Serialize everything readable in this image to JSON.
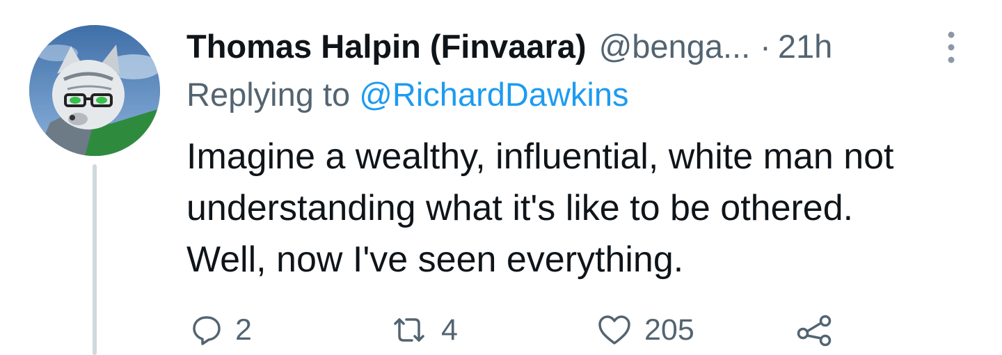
{
  "tweet": {
    "author_name": "Thomas Halpin (Finvaara)",
    "author_handle": "@benga...",
    "separator": "·",
    "time": "21h",
    "replying_to_prefix": "Replying to",
    "replying_to_handle": "@RichardDawkins",
    "text_lines": [
      "Imagine a wealthy, influential, white man not",
      "understanding what it's like to be othered.",
      "Well, now I've seen everything."
    ]
  },
  "actions": {
    "reply_count": "2",
    "retweet_count": "4",
    "like_count": "205"
  },
  "icons": {
    "more": "more-vertical-icon",
    "reply": "reply-bubble-icon",
    "retweet": "retweet-icon",
    "like": "heart-icon",
    "share": "share-icon"
  },
  "colors": {
    "text_primary": "#0f1419",
    "text_secondary": "#536471",
    "link": "#1d9bf0",
    "thread_line": "#cfd9de"
  }
}
